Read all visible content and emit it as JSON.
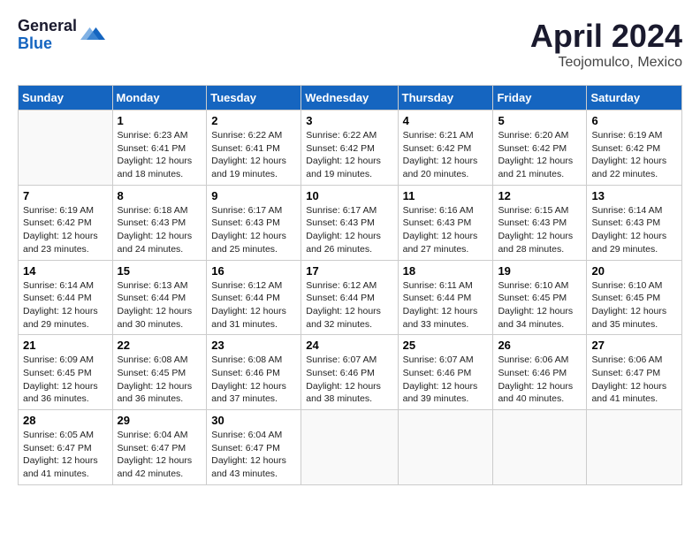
{
  "header": {
    "logo_general": "General",
    "logo_blue": "Blue",
    "month_title": "April 2024",
    "location": "Teojomulco, Mexico"
  },
  "days_of_week": [
    "Sunday",
    "Monday",
    "Tuesday",
    "Wednesday",
    "Thursday",
    "Friday",
    "Saturday"
  ],
  "weeks": [
    [
      {
        "day": "",
        "info": ""
      },
      {
        "day": "1",
        "info": "Sunrise: 6:23 AM\nSunset: 6:41 PM\nDaylight: 12 hours\nand 18 minutes."
      },
      {
        "day": "2",
        "info": "Sunrise: 6:22 AM\nSunset: 6:41 PM\nDaylight: 12 hours\nand 19 minutes."
      },
      {
        "day": "3",
        "info": "Sunrise: 6:22 AM\nSunset: 6:42 PM\nDaylight: 12 hours\nand 19 minutes."
      },
      {
        "day": "4",
        "info": "Sunrise: 6:21 AM\nSunset: 6:42 PM\nDaylight: 12 hours\nand 20 minutes."
      },
      {
        "day": "5",
        "info": "Sunrise: 6:20 AM\nSunset: 6:42 PM\nDaylight: 12 hours\nand 21 minutes."
      },
      {
        "day": "6",
        "info": "Sunrise: 6:19 AM\nSunset: 6:42 PM\nDaylight: 12 hours\nand 22 minutes."
      }
    ],
    [
      {
        "day": "7",
        "info": "Sunrise: 6:19 AM\nSunset: 6:42 PM\nDaylight: 12 hours\nand 23 minutes."
      },
      {
        "day": "8",
        "info": "Sunrise: 6:18 AM\nSunset: 6:43 PM\nDaylight: 12 hours\nand 24 minutes."
      },
      {
        "day": "9",
        "info": "Sunrise: 6:17 AM\nSunset: 6:43 PM\nDaylight: 12 hours\nand 25 minutes."
      },
      {
        "day": "10",
        "info": "Sunrise: 6:17 AM\nSunset: 6:43 PM\nDaylight: 12 hours\nand 26 minutes."
      },
      {
        "day": "11",
        "info": "Sunrise: 6:16 AM\nSunset: 6:43 PM\nDaylight: 12 hours\nand 27 minutes."
      },
      {
        "day": "12",
        "info": "Sunrise: 6:15 AM\nSunset: 6:43 PM\nDaylight: 12 hours\nand 28 minutes."
      },
      {
        "day": "13",
        "info": "Sunrise: 6:14 AM\nSunset: 6:43 PM\nDaylight: 12 hours\nand 29 minutes."
      }
    ],
    [
      {
        "day": "14",
        "info": "Sunrise: 6:14 AM\nSunset: 6:44 PM\nDaylight: 12 hours\nand 29 minutes."
      },
      {
        "day": "15",
        "info": "Sunrise: 6:13 AM\nSunset: 6:44 PM\nDaylight: 12 hours\nand 30 minutes."
      },
      {
        "day": "16",
        "info": "Sunrise: 6:12 AM\nSunset: 6:44 PM\nDaylight: 12 hours\nand 31 minutes."
      },
      {
        "day": "17",
        "info": "Sunrise: 6:12 AM\nSunset: 6:44 PM\nDaylight: 12 hours\nand 32 minutes."
      },
      {
        "day": "18",
        "info": "Sunrise: 6:11 AM\nSunset: 6:44 PM\nDaylight: 12 hours\nand 33 minutes."
      },
      {
        "day": "19",
        "info": "Sunrise: 6:10 AM\nSunset: 6:45 PM\nDaylight: 12 hours\nand 34 minutes."
      },
      {
        "day": "20",
        "info": "Sunrise: 6:10 AM\nSunset: 6:45 PM\nDaylight: 12 hours\nand 35 minutes."
      }
    ],
    [
      {
        "day": "21",
        "info": "Sunrise: 6:09 AM\nSunset: 6:45 PM\nDaylight: 12 hours\nand 36 minutes."
      },
      {
        "day": "22",
        "info": "Sunrise: 6:08 AM\nSunset: 6:45 PM\nDaylight: 12 hours\nand 36 minutes."
      },
      {
        "day": "23",
        "info": "Sunrise: 6:08 AM\nSunset: 6:46 PM\nDaylight: 12 hours\nand 37 minutes."
      },
      {
        "day": "24",
        "info": "Sunrise: 6:07 AM\nSunset: 6:46 PM\nDaylight: 12 hours\nand 38 minutes."
      },
      {
        "day": "25",
        "info": "Sunrise: 6:07 AM\nSunset: 6:46 PM\nDaylight: 12 hours\nand 39 minutes."
      },
      {
        "day": "26",
        "info": "Sunrise: 6:06 AM\nSunset: 6:46 PM\nDaylight: 12 hours\nand 40 minutes."
      },
      {
        "day": "27",
        "info": "Sunrise: 6:06 AM\nSunset: 6:47 PM\nDaylight: 12 hours\nand 41 minutes."
      }
    ],
    [
      {
        "day": "28",
        "info": "Sunrise: 6:05 AM\nSunset: 6:47 PM\nDaylight: 12 hours\nand 41 minutes."
      },
      {
        "day": "29",
        "info": "Sunrise: 6:04 AM\nSunset: 6:47 PM\nDaylight: 12 hours\nand 42 minutes."
      },
      {
        "day": "30",
        "info": "Sunrise: 6:04 AM\nSunset: 6:47 PM\nDaylight: 12 hours\nand 43 minutes."
      },
      {
        "day": "",
        "info": ""
      },
      {
        "day": "",
        "info": ""
      },
      {
        "day": "",
        "info": ""
      },
      {
        "day": "",
        "info": ""
      }
    ]
  ]
}
